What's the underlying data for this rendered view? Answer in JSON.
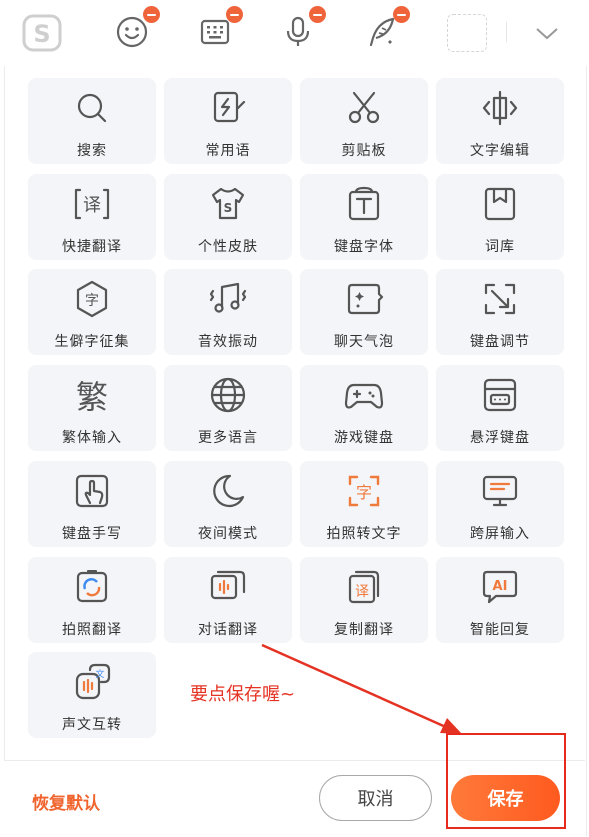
{
  "toolbar": {
    "icons": [
      "sogou-logo-icon",
      "emoji-icon",
      "keyboard-icon",
      "microphone-icon",
      "handwriting-quill-icon",
      "empty-slot",
      "chevron-down-icon"
    ]
  },
  "tiles": [
    {
      "label": "搜索",
      "icon": "search-icon"
    },
    {
      "label": "常用语",
      "icon": "phrases-icon"
    },
    {
      "label": "剪贴板",
      "icon": "scissors-icon"
    },
    {
      "label": "文字编辑",
      "icon": "text-edit-icon"
    },
    {
      "label": "快捷翻译",
      "icon": "translate-icon"
    },
    {
      "label": "个性皮肤",
      "icon": "tshirt-icon"
    },
    {
      "label": "键盘字体",
      "icon": "font-icon"
    },
    {
      "label": "词库",
      "icon": "dictionary-icon"
    },
    {
      "label": "生僻字征集",
      "icon": "rare-char-icon"
    },
    {
      "label": "音效振动",
      "icon": "music-vibrate-icon"
    },
    {
      "label": "聊天气泡",
      "icon": "chat-bubble-icon"
    },
    {
      "label": "键盘调节",
      "icon": "resize-icon"
    },
    {
      "label": "繁体输入",
      "icon": "traditional-char-icon"
    },
    {
      "label": "更多语言",
      "icon": "globe-icon"
    },
    {
      "label": "游戏键盘",
      "icon": "gamepad-icon"
    },
    {
      "label": "悬浮键盘",
      "icon": "floating-keyboard-icon"
    },
    {
      "label": "键盘手写",
      "icon": "handwrite-icon"
    },
    {
      "label": "夜间模式",
      "icon": "moon-icon"
    },
    {
      "label": "拍照转文字",
      "icon": "photo-text-icon"
    },
    {
      "label": "跨屏输入",
      "icon": "cross-screen-icon"
    },
    {
      "label": "拍照翻译",
      "icon": "photo-translate-icon"
    },
    {
      "label": "对话翻译",
      "icon": "dialog-translate-icon"
    },
    {
      "label": "复制翻译",
      "icon": "copy-translate-icon"
    },
    {
      "label": "智能回复",
      "icon": "ai-reply-icon"
    },
    {
      "label": "声文互转",
      "icon": "voice-text-icon"
    }
  ],
  "annotation": {
    "text": "要点保存喔~"
  },
  "footer": {
    "restore": "恢复默认",
    "cancel": "取消",
    "save": "保存"
  },
  "colors": {
    "accent": "#f0642e",
    "badge": "#f0643c",
    "annotation": "#e53323",
    "tile_bg": "#f4f5f8"
  }
}
